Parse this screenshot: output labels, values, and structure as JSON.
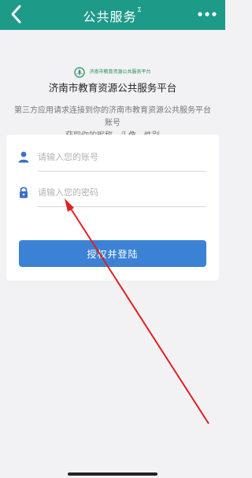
{
  "header": {
    "title": "公共服务",
    "title_suffix": "Σ"
  },
  "platform": {
    "logo_text": "济南市教育资源公共服务平台",
    "name": "济南市教育资源公共服务平台"
  },
  "description": {
    "line1": "第三方应用请求连接到你的济南市教育资源公共服务平台",
    "line2": "账号",
    "line3": "获取你的昵称、头像、性别"
  },
  "form": {
    "account_placeholder": "请输入您的账号",
    "password_placeholder": "请输入您的密码",
    "submit_label": "授权并登陆"
  },
  "colors": {
    "header": "#1e9b88",
    "button": "#3b82d4",
    "annotation_arrow": "#e02020"
  },
  "icons": {
    "back": "chevron-left-icon",
    "more": "more-dots-icon",
    "user": "user-icon",
    "lock": "lock-icon"
  }
}
